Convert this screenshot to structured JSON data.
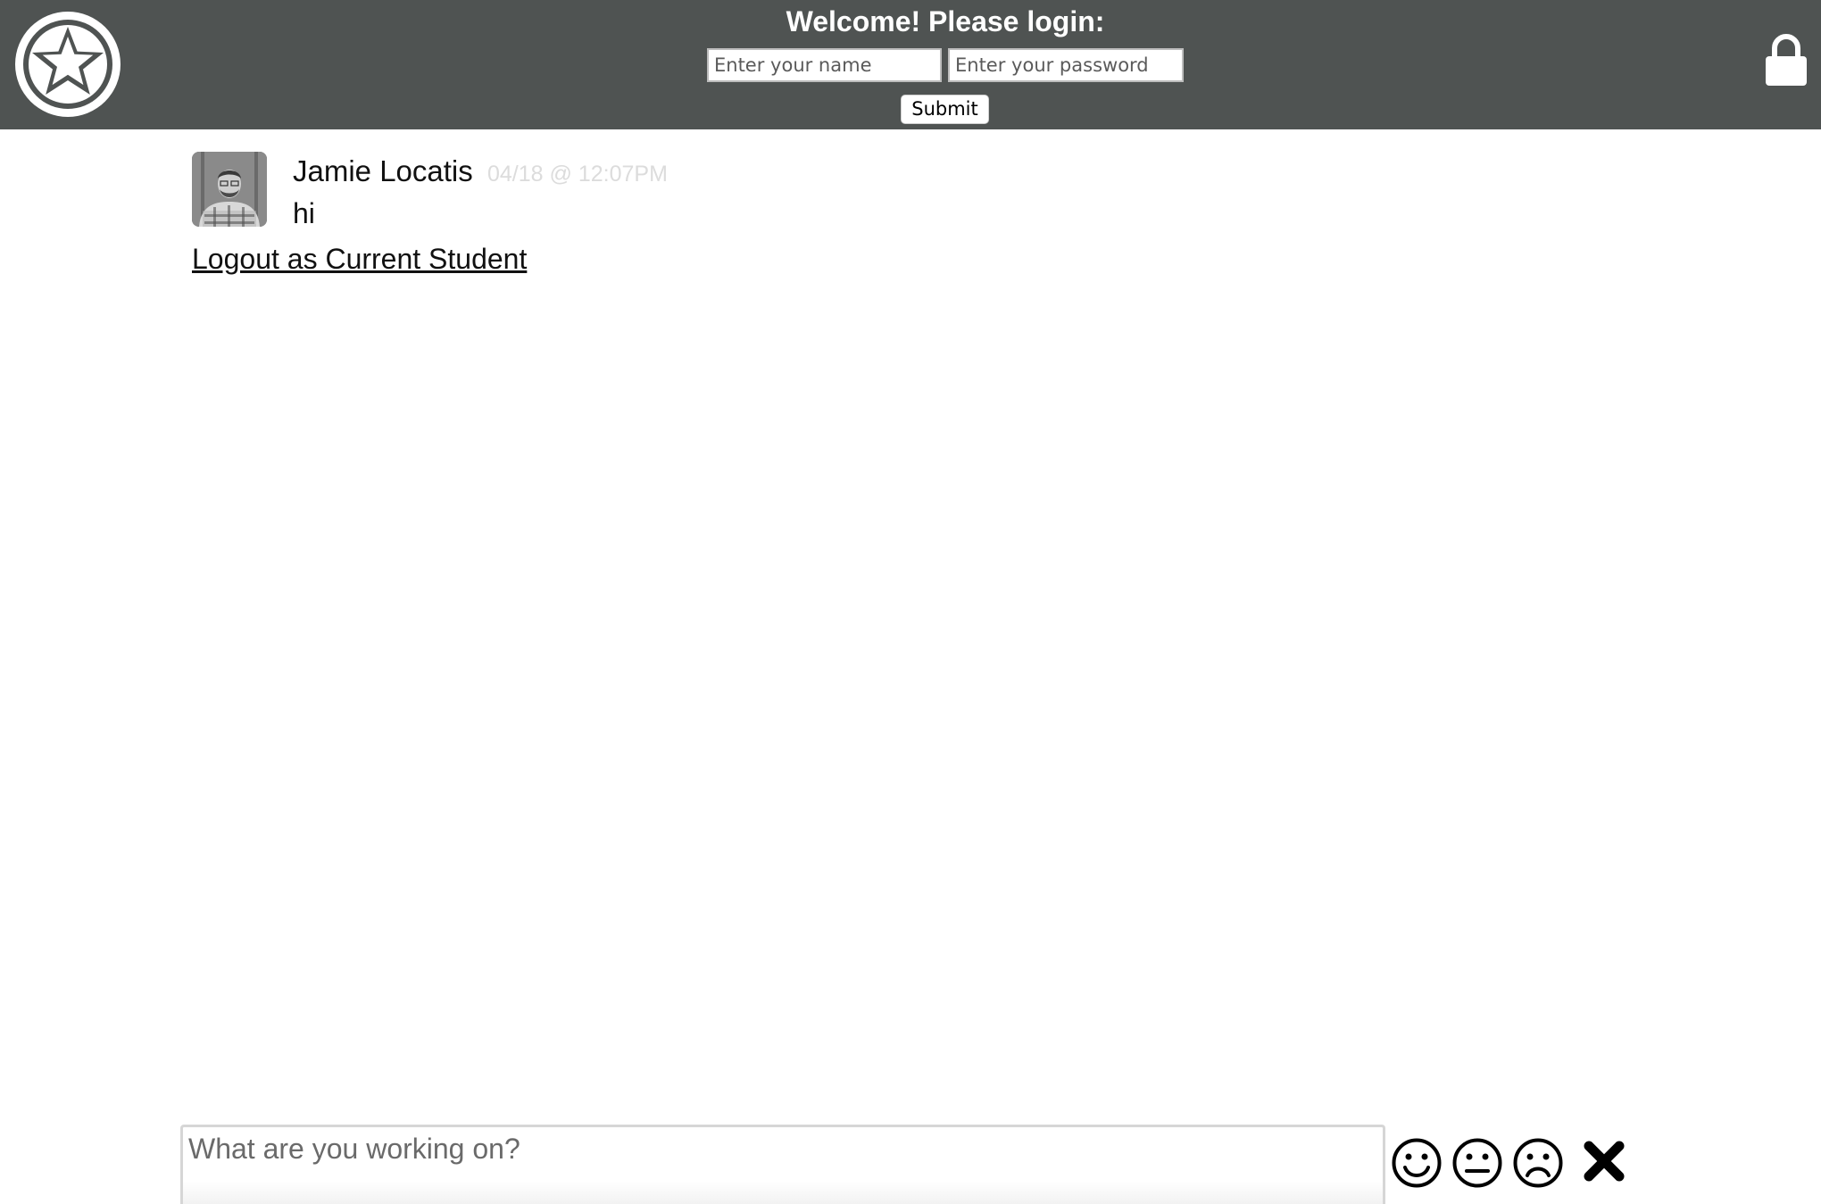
{
  "header": {
    "welcome_text": "Welcome! Please login:",
    "name_placeholder": "Enter your name",
    "password_placeholder": "Enter your password",
    "submit_label": "Submit",
    "background_color": "#4f5352",
    "logo_icon": "star-badge-icon",
    "lock_icon": "lock-icon"
  },
  "messages": [
    {
      "author": "Jamie Locatis",
      "timestamp": "04/18 @ 12:07PM",
      "text": "hi",
      "avatar_icon": "avatar"
    }
  ],
  "logout_label": "Logout as Current Student",
  "composer": {
    "placeholder": "What are you working on?",
    "moods": [
      "smiley-face-icon",
      "neutral-face-icon",
      "frowning-face-icon"
    ],
    "close_icon": "close-icon"
  }
}
